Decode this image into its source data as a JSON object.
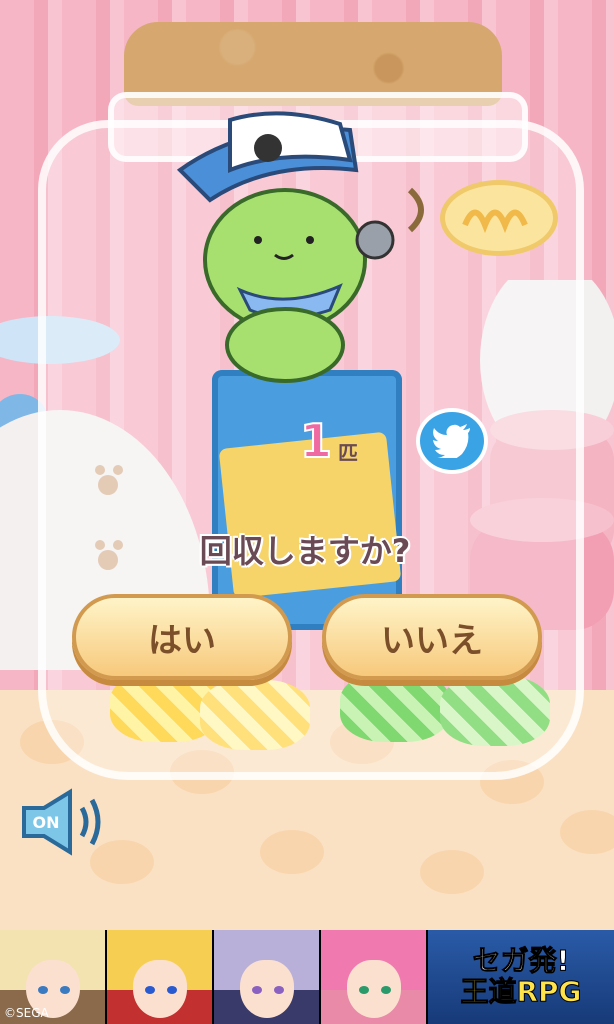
{
  "dialog": {
    "count_value": "1",
    "count_unit": "匹",
    "question": "回収しますか?",
    "yes_label": "はい",
    "no_label": "いいえ"
  },
  "sound": {
    "label": "ON"
  },
  "ad": {
    "line1": "セガ発!",
    "line2": "王道RPG",
    "credit": "©SEGA"
  },
  "colors": {
    "accent_pink": "#f06aa2",
    "button_fill": "#f7c97c",
    "button_text": "#7b4f2a",
    "twitter_blue": "#3aa3e6"
  },
  "icons": [
    "twitter-icon",
    "speaker-icon",
    "pirate-cat-character"
  ]
}
